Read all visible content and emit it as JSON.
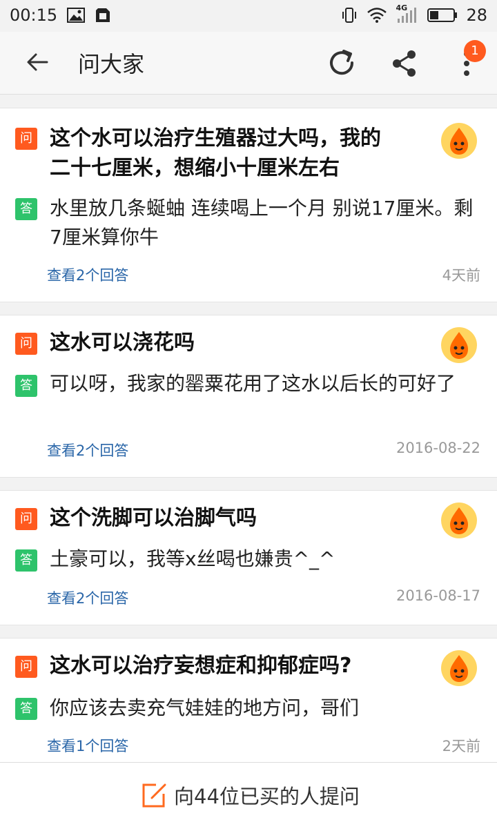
{
  "status_bar": {
    "time": "00:15",
    "network": "4G",
    "battery": "28"
  },
  "app_bar": {
    "title": "问大家",
    "notification_count": "1"
  },
  "items": [
    {
      "q_tag": "问",
      "question": "这个水可以治疗生殖器过大吗，我的二十七厘米，想缩小十厘米左右",
      "a_tag": "答",
      "answer": "水里放几条蜒蚰 连续喝上一个月 别说17厘米。剩7厘米算你牛",
      "link": "查看2个回答",
      "date": "4天前"
    },
    {
      "q_tag": "问",
      "question": "这水可以浇花吗",
      "a_tag": "答",
      "answer": "可以呀，我家的罂粟花用了这水以后长的可好了",
      "link": "查看2个回答",
      "date": "2016-08-22"
    },
    {
      "q_tag": "问",
      "question": "这个洗脚可以治脚气吗",
      "a_tag": "答",
      "answer": "土豪可以，我等x丝喝也嫌贵^_^",
      "link": "查看2个回答",
      "date": "2016-08-17"
    },
    {
      "q_tag": "问",
      "question": "这水可以治疗妄想症和抑郁症吗?",
      "a_tag": "答",
      "answer": "你应该去卖充气娃娃的地方问，哥们",
      "link": "查看1个回答",
      "date": "2天前"
    }
  ],
  "bottom_bar": {
    "ask_label": "向44位已买的人提问"
  },
  "colors": {
    "question_tag": "#ff5a1f",
    "answer_tag": "#2ec36b",
    "link": "#2a66a8",
    "badge": "#ff5a1f"
  },
  "icons": [
    "back-arrow-icon",
    "refresh-icon",
    "share-icon",
    "more-vertical-icon",
    "edit-icon",
    "avatar-icon"
  ]
}
